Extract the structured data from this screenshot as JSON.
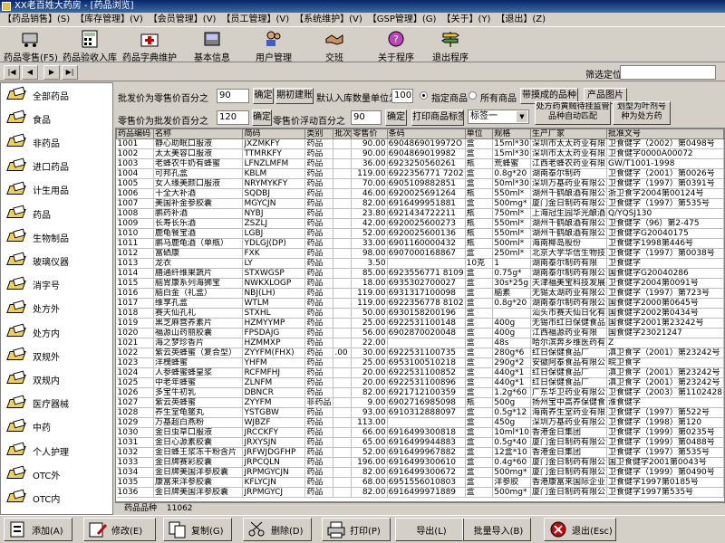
{
  "window": {
    "title": "XX老百姓大药房 - [药品浏览]"
  },
  "menu": [
    "【药品销售】(S)",
    "【库存管理】(V)",
    "【会员管理】(V)",
    "【员工管理】(V)",
    "【系统维护】(V)",
    "【GSP管理】(G)",
    "【关于】(Y)",
    "【退出】(Z)"
  ],
  "toolbar": {
    "sale": "药品零售(F5)",
    "inbound": "药品验收入库",
    "dict": "药品字典维护",
    "basic": "基本信息",
    "user": "用户管理",
    "shift": "交班",
    "about": "关于程序",
    "exit": "退出程序"
  },
  "nav": {
    "filter_label": "筛选定位",
    "filter_value": ""
  },
  "sidebar": [
    "全部药品",
    "食品",
    "非药品",
    "进口药品",
    "计生用品",
    "药品",
    "生物制品",
    "玻璃仪器",
    "消字号",
    "处方外",
    "处方内",
    "双规外",
    "双规内",
    "医疗器械",
    "中药",
    "个人护理",
    "OTC外",
    "OTC内"
  ],
  "controls": {
    "wholesale_label": "批发价为零售价百分之",
    "wholesale_value": "90",
    "confirm1": "确定",
    "period_account": "期初建账",
    "default_qty_label": "默认入库数量单位为",
    "default_qty_value": "100",
    "radio_specified": "指定商品",
    "radio_all": "所有商品",
    "with_product": "带摸成的品种",
    "product_image": "产品图片",
    "retail_label": "零售价为批发价百分之",
    "retail_value": "120",
    "confirm2": "确定",
    "float_label": "零售价浮动百分之",
    "float_value": "90",
    "confirm3": "确定",
    "print_label": "打印商品标签",
    "label_select": "标签一",
    "rx_supervision": "处方药黄贼待挂监管品种自动匹配",
    "set_rx": "划型为叶剂号种为处方药"
  },
  "table": {
    "headers": [
      "药品编码",
      "名称",
      "简码",
      "类别",
      "批次",
      "零售价",
      "条码",
      "单位",
      "规格",
      "生产厂家",
      "批准文号"
    ],
    "rows": [
      [
        "1001",
        "静心助眠口服液",
        "JXZMKFY",
        "药品",
        "",
        "90.00",
        "6904869019972O",
        "盒",
        "15ml*30",
        "深圳市太太药业有限",
        "卫食健字（2002）第0498号"
      ],
      [
        "1002",
        "太太美容口服液",
        "TTMRKFY",
        "药品",
        "",
        "90.00",
        "6904869019982",
        "盒",
        "15ml*30",
        "深圳市太太药业有限",
        "卫食健字0000A00072"
      ],
      [
        "1003",
        "老蜂农牛奶有蜂蜜",
        "LFNZLMFM",
        "药品",
        "",
        "36.00",
        "6923250560261",
        "瓶",
        "荒蜂蜜",
        "江西老蜂农药业有限",
        "GW/T1001-1998"
      ],
      [
        "1004",
        "可邦孔盒",
        "KBLM",
        "药品",
        "",
        "119.00",
        "6922356771 7202",
        "盒",
        "0.8g*20",
        "湖南泰尔制药",
        "卫食健字（2001）第0026号"
      ],
      [
        "1005",
        "女人缘美颜口服液",
        "NRYMYKFY",
        "药品",
        "",
        "70.00",
        "6905109882851",
        "盒",
        "50ml*30",
        "深圳万基药业有限公",
        "卫食健字（1997）第0391号"
      ],
      [
        "1006",
        "十全大补酒",
        "SQDBJ",
        "药品",
        "",
        "46.00",
        "6920025691264",
        "瓶",
        "550ml*",
        "湖州千鹤酿酒有限公",
        "浙卫食字2004第00124号"
      ],
      [
        "1007",
        "美国补金参胶囊",
        "MGYCJN",
        "药品",
        "",
        "82.00",
        "6916499951881",
        "盒",
        "500mg*",
        "厦门金日制药有限公",
        "卫食健字（1997）第535号"
      ],
      [
        "1008",
        "鹏药补酒",
        "NYBJ",
        "药品",
        "",
        "23.80",
        "6921434722211",
        "瓶",
        "750ml*",
        "上海冠生园华光酿酒",
        "Q/YQSJ130"
      ],
      [
        "1009",
        "长寿长乐酒",
        "ZSZLJ",
        "药品",
        "",
        "42.00",
        "6920025600273",
        "瓶",
        "550ml*",
        "湖州千鹤酿酒有限公",
        "卫食健字（96）第2-475"
      ],
      [
        "1010",
        "鹿龟餐宝酒",
        "LGBJ",
        "药品",
        "",
        "52.00",
        "6920025600136",
        "瓶",
        "550ml*",
        "湖州千鹤酿酒有限公",
        "卫食健字G20040175"
      ],
      [
        "1011",
        "鹏马鹿龟酒（单瓶）",
        "YDLGJ(DP)",
        "药品",
        "",
        "33.00",
        "6901160000432",
        "瓶",
        "500ml*",
        "海南椰岛股份",
        "卫食健字1998第446号"
      ],
      [
        "1012",
        "富硒康",
        "FXK",
        "药品",
        "",
        "98.00",
        "6907000168867",
        "盒",
        "250ml*",
        "北京大学华信生物技",
        "卫食健字（1997）第0038号"
      ],
      [
        "1013",
        "龙衣",
        "LY",
        "药品",
        "",
        "3.50",
        "",
        "10克",
        "1",
        "湖南泰尔制药有限",
        "卫食健字"
      ],
      [
        "1014",
        "膳通纤维果蔬片",
        "STXWGSP",
        "药品",
        "",
        "85.00",
        "6923556771 8109",
        "盒",
        "0.75g*",
        "湖南泰尔制药有限公",
        "国食健字G20040286"
      ],
      [
        "1015",
        "脑胃康系列海狮宝",
        "NWKXLOGP",
        "药品",
        "",
        "18.00",
        "6935302700027",
        "盒",
        "30s*25g",
        "天津福美宝科技发展",
        "卫食健字2004第0091号"
      ],
      [
        "1016",
        "脑白金（礼盒）",
        "NBJ(LH)",
        "药品",
        "",
        "119.00",
        "6931317100098",
        "盒",
        "脑素",
        "无锡太湖药业有限公",
        "卫食健字（1997）第723号"
      ],
      [
        "1017",
        "维享孔盒",
        "WTLM",
        "药品",
        "",
        "119.00",
        "6922356778 8102",
        "盒",
        "0.8g*20",
        "湖南泰尔制药有限公",
        "国食健字2000第0645号"
      ],
      [
        "1018",
        "赛天仙孔礼",
        "STXHL",
        "药品",
        "",
        "50.00",
        "6930158200196",
        "盒",
        "",
        "汕头市赛天仙日化有",
        "国食健字2002第0434号"
      ],
      [
        "1019",
        "黑芝麻营养素片",
        "HZMYYMP",
        "药品",
        "",
        "25.00",
        "6922531100148",
        "盒",
        "400g",
        "无锡市红日保健食品",
        "国食健字2001第23242号"
      ],
      [
        "1020",
        "福源山药丽胶囊",
        "FPSDAJG",
        "药品",
        "",
        "56.00",
        "6902870020048",
        "盒",
        "400g",
        "江西福源药业有限",
        "国食健字23021247"
      ],
      [
        "1021",
        "海之梦珍香片",
        "HZMMXP",
        "药品",
        "",
        "22.00",
        "",
        "盒",
        "48s",
        "哈尔滨奔乡维医药有",
        "Z"
      ],
      [
        "1022",
        "紫云英蜂蜜（复合型）",
        "ZYYFM(FHX)",
        "药品",
        ".00",
        "30.00",
        "6922531100735",
        "盒",
        "280g*6",
        "红日保健食品厂",
        "滇卫食字（2001）第23242号"
      ],
      [
        "1023",
        "洋槐蜂蜜",
        "YHFM",
        "药品",
        "",
        "25.00",
        "6953100510218",
        "盒",
        "290g*2",
        "安徽阿泰食品有限公",
        "皖卫食字"
      ],
      [
        "1024",
        "人参蜂蜜蜂皇浆",
        "RCFMFHJ",
        "药品",
        "",
        "20.00",
        "6922531100852",
        "盒",
        "440g*1",
        "红日保健食品厂",
        "滇卫食字（2001）第23242号"
      ],
      [
        "1025",
        "中老年蜂蜜",
        "ZLNFM",
        "药品",
        "",
        "20.00",
        "6922531100896",
        "盒",
        "440g*1",
        "红日保健食品厂",
        "滇卫食字（2001）第23242号"
      ],
      [
        "1026",
        "多宝牛初乳",
        "DBNCR",
        "药品",
        "",
        "82.00",
        "6921712100359",
        "盒",
        "1.2g*60",
        "广东华卫药业有限公",
        "卫食健字（2003）第1102428"
      ],
      [
        "1027",
        "紫云英蜂蜜",
        "ZYYFM",
        "非药品",
        "",
        "9.00",
        "6902716985098",
        "瓶",
        "500g",
        "扬州宝中高养保健食",
        "淮食健字"
      ],
      [
        "1028",
        "养生堂龟鳖丸",
        "YSTGBW",
        "药品",
        "",
        "93.00",
        "6910312888097",
        "盒",
        "0.5g*12",
        "海南养生堂药业有限",
        "卫食健字（1997）第522号"
      ],
      [
        "1029",
        "万基超白燕粉",
        "WJBZF",
        "药品",
        "",
        "113.00",
        "",
        "盒",
        "450g",
        "深圳万基药业有限公",
        "卫食健字（1998）第120"
      ],
      [
        "1030",
        "金日虫草口服液",
        "JRCCKFY",
        "药品",
        "",
        "66.00",
        "6916499300818",
        "盒",
        "10ml*10",
        "香港金日集团",
        "卫食健字（1999）第0235号"
      ],
      [
        "1031",
        "金日心源素胶囊",
        "JRXYSJN",
        "药品",
        "",
        "65.00",
        "6916499944883",
        "盒",
        "0.5g*40",
        "厦门金日制药有限公",
        "卫食健字（1999）第0488号"
      ],
      [
        "1032",
        "金日蜂王浆冻干粉含片",
        "JRFWJDGFHP",
        "药品",
        "",
        "52.00",
        "6916499967882",
        "盒",
        "12盒*10",
        "香港金日集团",
        "卫食健字（1997）第535号"
      ],
      [
        "1033",
        "金日牌赛彩胶囊",
        "JRPCQLN",
        "药品",
        "",
        "196.00",
        "6916499300610",
        "盒",
        "0.4g*60",
        "厦门金日制药有限公",
        "国卫食健字2001第0043号"
      ],
      [
        "1034",
        "金日牌美国洋参胶囊",
        "JRPMGYCJN",
        "药品",
        "",
        "82.00",
        "6916499300672",
        "盒",
        "500mg*",
        "厦门金日制药有限公",
        "卫食健字（1999）第0490号"
      ],
      [
        "1035",
        "康富来洋参胶囊",
        "KFLYCJN",
        "药品",
        "",
        "68.00",
        "6951556010803",
        "盒",
        "洋参胶",
        "香港康富来国际企业",
        "卫食健字1997第0185号"
      ],
      [
        "1036",
        "金日牌美国洋参胶囊",
        "JRPMGYCJ",
        "药品",
        "",
        "82.00",
        "6916499971889",
        "盒",
        "500mg*",
        "厦门金日制药有限公",
        "卫食健字1997第535号"
      ]
    ]
  },
  "footer": {
    "label": "药品品种",
    "count": "11062"
  },
  "bottom": {
    "add": "添加(A)",
    "edit": "修改(E)",
    "copy": "复制(G)",
    "delete": "删除(D)",
    "print": "打印(P)",
    "export": "导出(L)",
    "import": "批量导入(B)",
    "exit": "退出(Esc)"
  },
  "colors": {
    "title": "#0a246a",
    "face": "#d4d0c8",
    "accent": "#f0d050"
  }
}
